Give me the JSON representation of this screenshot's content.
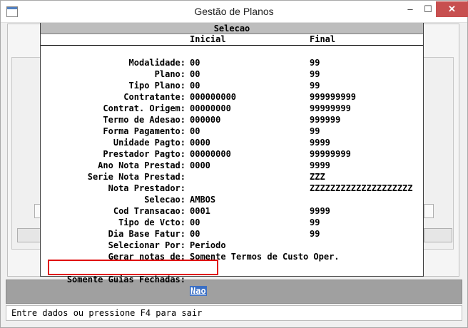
{
  "window": {
    "title": "Gestão de Planos",
    "minimize": "–",
    "maximize": "☐",
    "close": "✕"
  },
  "dialog": {
    "title": "Selecao",
    "header_inicial": "Inicial",
    "header_final": "Final",
    "rows": [
      {
        "label": "Modalidade:",
        "inicial": "00",
        "final": "99"
      },
      {
        "label": "Plano:",
        "inicial": "00",
        "final": "99"
      },
      {
        "label": "Tipo Plano:",
        "inicial": "00",
        "final": "99"
      },
      {
        "label": "Contratante:",
        "inicial": "000000000",
        "final": "999999999"
      },
      {
        "label": "Contrat. Origem:",
        "inicial": "00000000",
        "final": "99999999"
      },
      {
        "label": "Termo de Adesao:",
        "inicial": "000000",
        "final": "999999"
      },
      {
        "label": "Forma Pagamento:",
        "inicial": "00",
        "final": "99"
      },
      {
        "label": "Unidade Pagto:",
        "inicial": "0000",
        "final": "9999"
      },
      {
        "label": "Prestador Pagto:",
        "inicial": "00000000",
        "final": "99999999"
      },
      {
        "label": "Ano Nota Prestad:",
        "inicial": "0000",
        "final": "9999"
      },
      {
        "label": "Serie Nota Prestad:",
        "inicial": "",
        "final": "ZZZ"
      },
      {
        "label": "Nota Prestador:",
        "inicial": "",
        "final": "ZZZZZZZZZZZZZZZZZZZZ"
      },
      {
        "label": "Selecao:",
        "inicial": "AMBOS",
        "final": ""
      },
      {
        "label": "Cod Transacao:",
        "inicial": "0001",
        "final": "9999"
      },
      {
        "label": "Tipo de Vcto:",
        "inicial": "00",
        "final": "99"
      },
      {
        "label": "Dia Base Fatur:",
        "inicial": "00",
        "final": "99"
      },
      {
        "label": "Selecionar Por:",
        "inicial": "Periodo",
        "final": ""
      },
      {
        "label": "Gerar notas de:",
        "inicial": "Somente Termos de Custo Oper.",
        "final": ""
      }
    ],
    "last_row": {
      "label": "Somente Guias Fechadas:",
      "value": "Nao"
    }
  },
  "status": {
    "text": "Entre dados ou pressione F4 para sair"
  },
  "colors": {
    "highlight_border": "#e01010",
    "selected_value_bg": "#3a6fc4",
    "bottom_bar": "#a0a0a0"
  },
  "icons": {
    "app": "app-window-icon"
  }
}
